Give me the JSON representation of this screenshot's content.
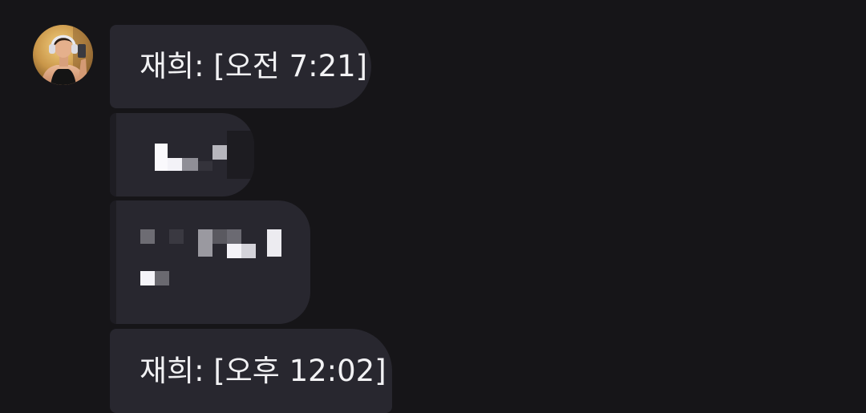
{
  "chat": {
    "sender": {
      "avatar_icon": "profile-photo-icon"
    },
    "messages": [
      {
        "id": "msg1",
        "text": "재희: [오전 7:21]",
        "redacted": false
      },
      {
        "id": "msg2",
        "text": "",
        "redacted": true
      },
      {
        "id": "msg3",
        "text": "",
        "redacted": true
      },
      {
        "id": "msg4",
        "text": "재희: [오후 12:02]",
        "redacted": false
      }
    ]
  },
  "colors": {
    "background": "#161518",
    "bubble": "#28272f",
    "text": "#f2f2f4"
  }
}
